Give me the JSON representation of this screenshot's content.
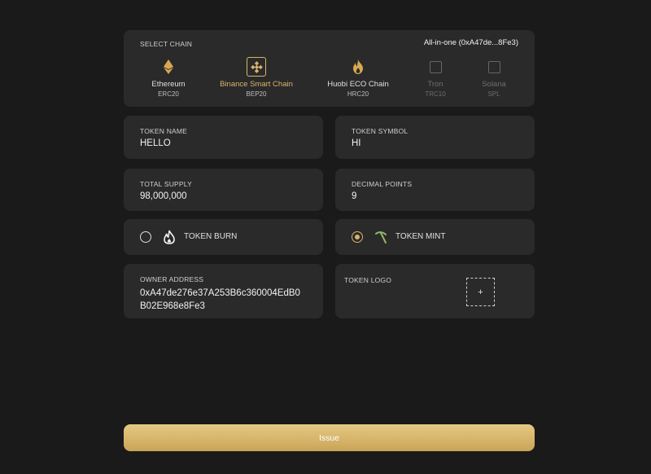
{
  "chain_section": {
    "label": "SELECT CHAIN",
    "wallet": "All-in-one  (0xA47de...8Fe3)",
    "chains": [
      {
        "name": "Ethereum",
        "standard": "ERC20",
        "icon": "ethereum-icon",
        "state": "normal"
      },
      {
        "name": "Binance Smart Chain",
        "standard": "BEP20",
        "icon": "binance-icon",
        "state": "selected"
      },
      {
        "name": "Huobi ECO Chain",
        "standard": "HRC20",
        "icon": "huobi-flame-icon",
        "state": "normal"
      },
      {
        "name": "Tron",
        "standard": "TRC10",
        "icon": "empty-box-icon",
        "state": "disabled"
      },
      {
        "name": "Solana",
        "standard": "SPL",
        "icon": "empty-box-icon",
        "state": "disabled"
      }
    ]
  },
  "token_name": {
    "label": "TOKEN NAME",
    "value": "HELLO"
  },
  "token_symbol": {
    "label": "TOKEN SYMBOL",
    "value": "HI"
  },
  "total_supply": {
    "label": "TOTAL SUPPLY",
    "value": "98,000,000"
  },
  "decimal_points": {
    "label": "DECIMAL POINTS",
    "value": "9"
  },
  "token_burn": {
    "label": "TOKEN BURN",
    "selected": false,
    "icon": "flame-icon"
  },
  "token_mint": {
    "label": "TOKEN MINT",
    "selected": true,
    "icon": "pickaxe-icon"
  },
  "owner_address": {
    "label": "OWNER ADDRESS",
    "value": "0xA47de276e37A253B6c360004EdB0B02E968e8Fe3"
  },
  "token_logo": {
    "label": "TOKEN LOGO",
    "upload_symbol": "+"
  },
  "issue_button": {
    "label": "Issue"
  },
  "colors": {
    "accent": "#d9b46a",
    "card": "#2a2a2a",
    "background": "#1a1a1a"
  }
}
